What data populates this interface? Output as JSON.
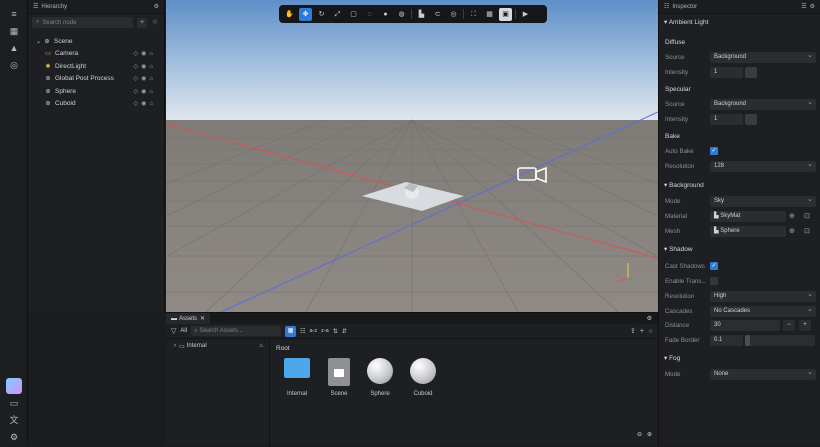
{
  "left_toolbar": {
    "icons": [
      "menu-icon",
      "layout-icon",
      "shapes-icon",
      "compass-icon",
      "app-icon",
      "panel-icon",
      "translate-icon",
      "settings-icon"
    ]
  },
  "hierarchy": {
    "title": "Hierarchy",
    "search_placeholder": "Search node",
    "items": [
      {
        "label": "Scene"
      },
      {
        "label": "Camera"
      },
      {
        "label": "DirectLight"
      },
      {
        "label": "Global Post Process"
      },
      {
        "label": "Sphere"
      },
      {
        "label": "Cuboid"
      }
    ]
  },
  "scene_toolbar": {
    "zoom_labels": []
  },
  "assets": {
    "tab_title": "Assets",
    "filter_label": "All",
    "search_placeholder": "Search Assets...",
    "sort_labels": [
      "a-z",
      "z-a"
    ],
    "tree": [
      {
        "label": "Internal"
      }
    ],
    "breadcrumb": "Root",
    "items": [
      {
        "label": "Internal",
        "type": "folder"
      },
      {
        "label": "Scene",
        "type": "scene"
      },
      {
        "label": "Sphere",
        "type": "sphere"
      },
      {
        "label": "Cuboid",
        "type": "sphere"
      }
    ]
  },
  "inspector": {
    "title": "Inspector",
    "ambient_light": "Ambient Light",
    "diffuse": {
      "heading": "Diffuse",
      "source_label": "Source",
      "source_value": "Background",
      "intensity_label": "Intensity",
      "intensity_value": "1"
    },
    "specular": {
      "heading": "Specular",
      "source_label": "Source",
      "source_value": "Background",
      "intensity_label": "Intensity",
      "intensity_value": "1"
    },
    "bake": {
      "heading": "Bake",
      "auto_bake_label": "Auto Bake",
      "auto_bake": true,
      "resolution_label": "Resolution",
      "resolution_value": "128"
    },
    "background": {
      "heading": "Background",
      "mode_label": "Mode",
      "mode_value": "Sky",
      "material_label": "Material",
      "material_value": "SkyMat",
      "mesh_label": "Mesh",
      "mesh_value": "Sphere"
    },
    "shadow": {
      "heading": "Shadow",
      "cast_label": "Cast Shadows",
      "cast": true,
      "enable_trans_label": "Enable Trans...",
      "enable_trans": false,
      "resolution_label": "Resolution",
      "resolution_value": "High",
      "cascades_label": "Cascades",
      "cascades_value": "No Cascades",
      "distance_label": "Distance",
      "distance_value": "30",
      "fade_label": "Fade Border",
      "fade_value": "0.1"
    },
    "fog": {
      "heading": "Fog",
      "mode_label": "Mode",
      "mode_value": "None"
    }
  },
  "colors": {
    "accent": "#2f7bd9",
    "x_axis": "#e25555",
    "z_axis": "#5a6ed9",
    "panel": "#1e1f22"
  }
}
